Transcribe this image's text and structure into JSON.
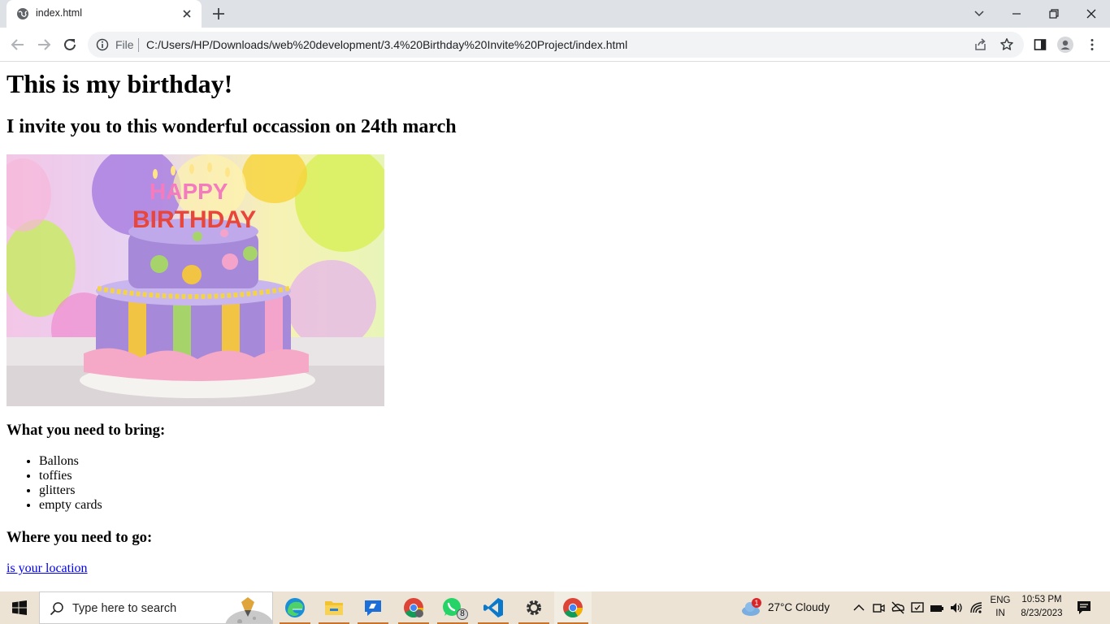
{
  "browser": {
    "tab_title": "index.html",
    "omnibox": {
      "chip": "File",
      "url": "C:/Users/HP/Downloads/web%20development/3.4%20Birthday%20Invite%20Project/index.html"
    }
  },
  "page": {
    "heading": "This is my birthday!",
    "subheading": "I invite you to this wonderful occassion on 24th march",
    "image": {
      "happy_text": "HAPPY",
      "birthday_text": "BIRTHDAY"
    },
    "bring_heading": "What you need to bring:",
    "bring_items": [
      "Ballons",
      "toffies",
      "glitters",
      "empty cards"
    ],
    "go_heading": "Where you need to go:",
    "location_link": "is your location"
  },
  "taskbar": {
    "search_placeholder": "Type here to search",
    "whatsapp_badge": "8",
    "weather_badge": "1",
    "weather": "27°C  Cloudy",
    "lang_top": "ENG",
    "lang_bottom": "IN",
    "time": "10:53 PM",
    "date": "8/23/2023"
  },
  "colors": {
    "tabstrip": "#dee1e6",
    "link": "#0000ee",
    "taskbar": "#ece3d4"
  }
}
